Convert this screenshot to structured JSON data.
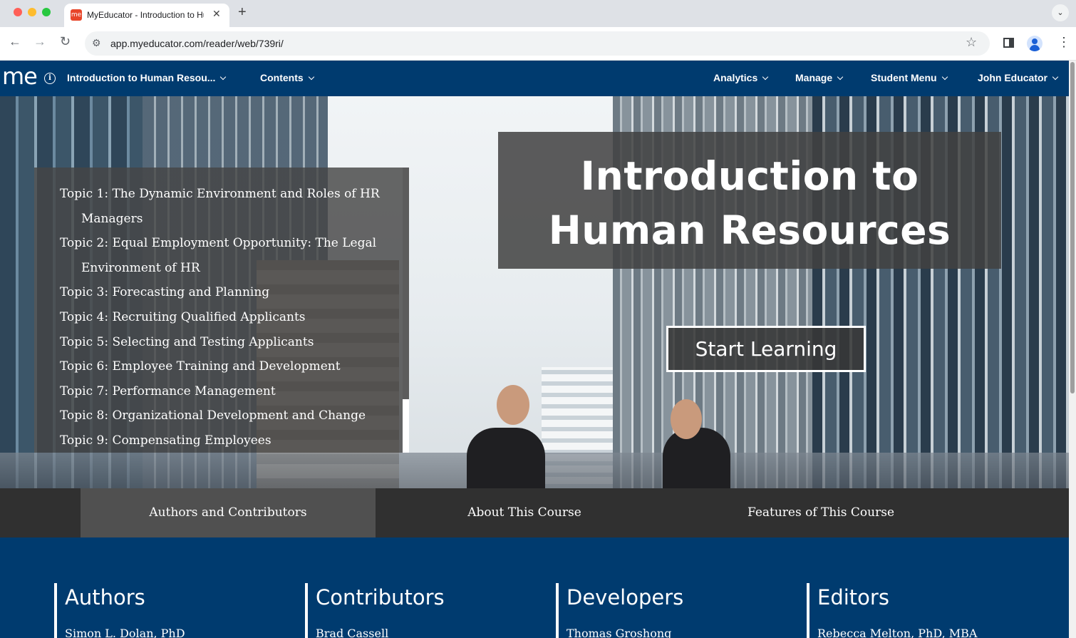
{
  "browser": {
    "tab_title": "MyEducator - Introduction to Human Resources",
    "favicon_text": "me",
    "url": "app.myeducator.com/reader/web/739ri/"
  },
  "nav": {
    "logo": "me",
    "course_menu": "Introduction to Human Resou...",
    "contents": "Contents",
    "analytics": "Analytics",
    "manage": "Manage",
    "student_menu": "Student Menu",
    "user": "John Educator"
  },
  "topics": [
    "Topic 1: The Dynamic Environment and Roles of HR Managers",
    "Topic 2: Equal Employment Opportunity: The Legal Environment of HR",
    "Topic 3: Forecasting and Planning",
    "Topic 4: Recruiting Qualified Applicants",
    "Topic 5: Selecting and Testing Applicants",
    "Topic 6: Employee Training and Development",
    "Topic 7: Performance Management",
    "Topic 8: Organizational Development and Change",
    "Topic 9: Compensating Employees"
  ],
  "hero": {
    "title_line1": "Introduction to",
    "title_line2": "Human Resources",
    "start_label": "Start Learning"
  },
  "course_tabs": [
    {
      "label": "Authors and Contributors",
      "active": true
    },
    {
      "label": "About This Course",
      "active": false
    },
    {
      "label": "Features of This Course",
      "active": false
    }
  ],
  "credits": [
    {
      "heading": "Authors",
      "name": "Simon L. Dolan, PhD"
    },
    {
      "heading": "Contributors",
      "name": "Brad Cassell"
    },
    {
      "heading": "Developers",
      "name": "Thomas Groshong"
    },
    {
      "heading": "Editors",
      "name": "Rebecca Melton, PhD, MBA"
    }
  ],
  "colors": {
    "nav_bg": "#003b6f",
    "tab_bar_bg": "#303030",
    "tab_active_bg": "#505050"
  }
}
